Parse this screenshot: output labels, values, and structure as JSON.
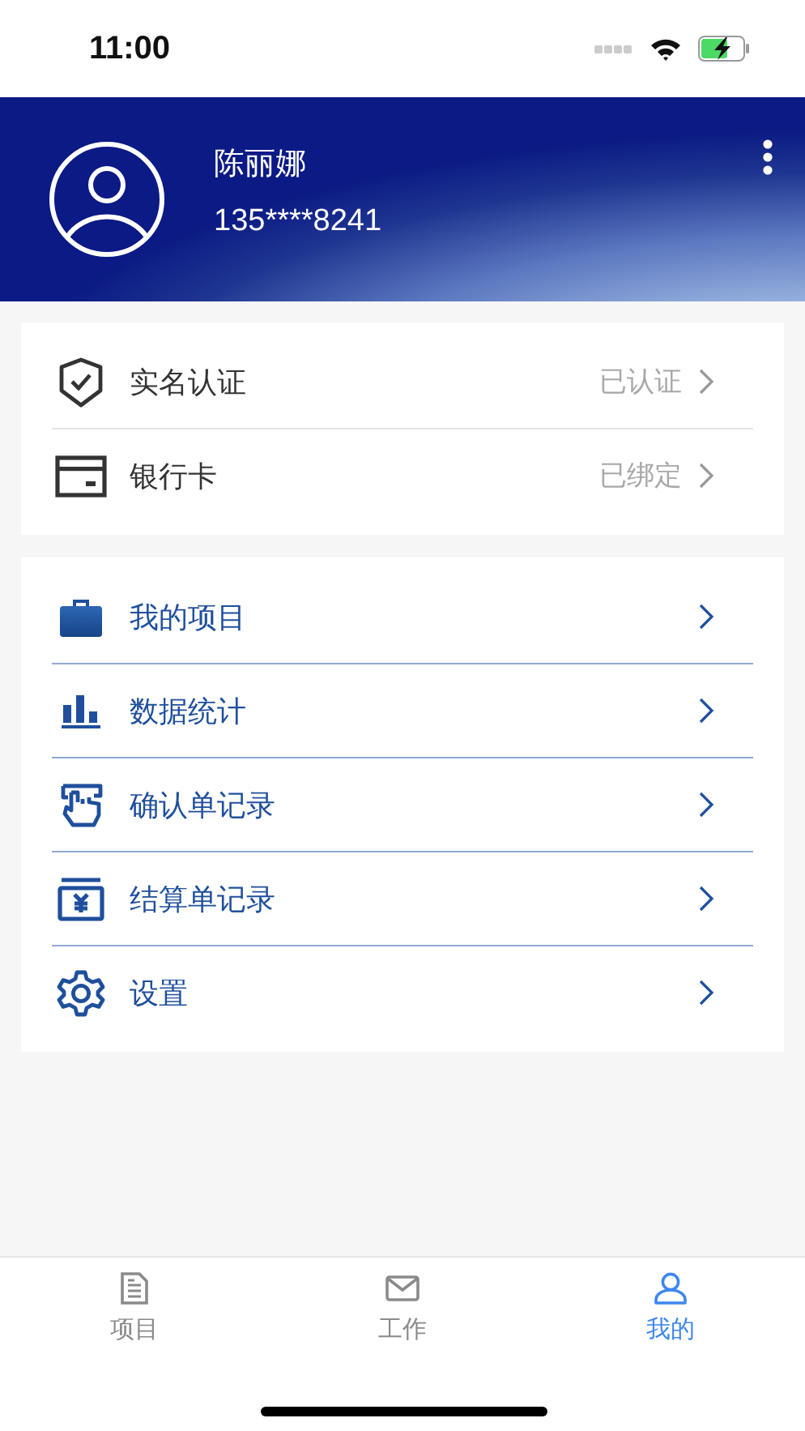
{
  "status_bar": {
    "time": "11:00"
  },
  "profile": {
    "name": "陈丽娜",
    "phone": "135****8241"
  },
  "account_items": [
    {
      "label": "实名认证",
      "status": "已认证"
    },
    {
      "label": "银行卡",
      "status": "已绑定"
    }
  ],
  "menu_items": [
    {
      "label": "我的项目"
    },
    {
      "label": "数据统计"
    },
    {
      "label": "确认单记录"
    },
    {
      "label": "结算单记录"
    },
    {
      "label": "设置"
    }
  ],
  "tabs": [
    {
      "label": "项目",
      "selected": false
    },
    {
      "label": "工作",
      "selected": false
    },
    {
      "label": "我的",
      "selected": true
    }
  ]
}
